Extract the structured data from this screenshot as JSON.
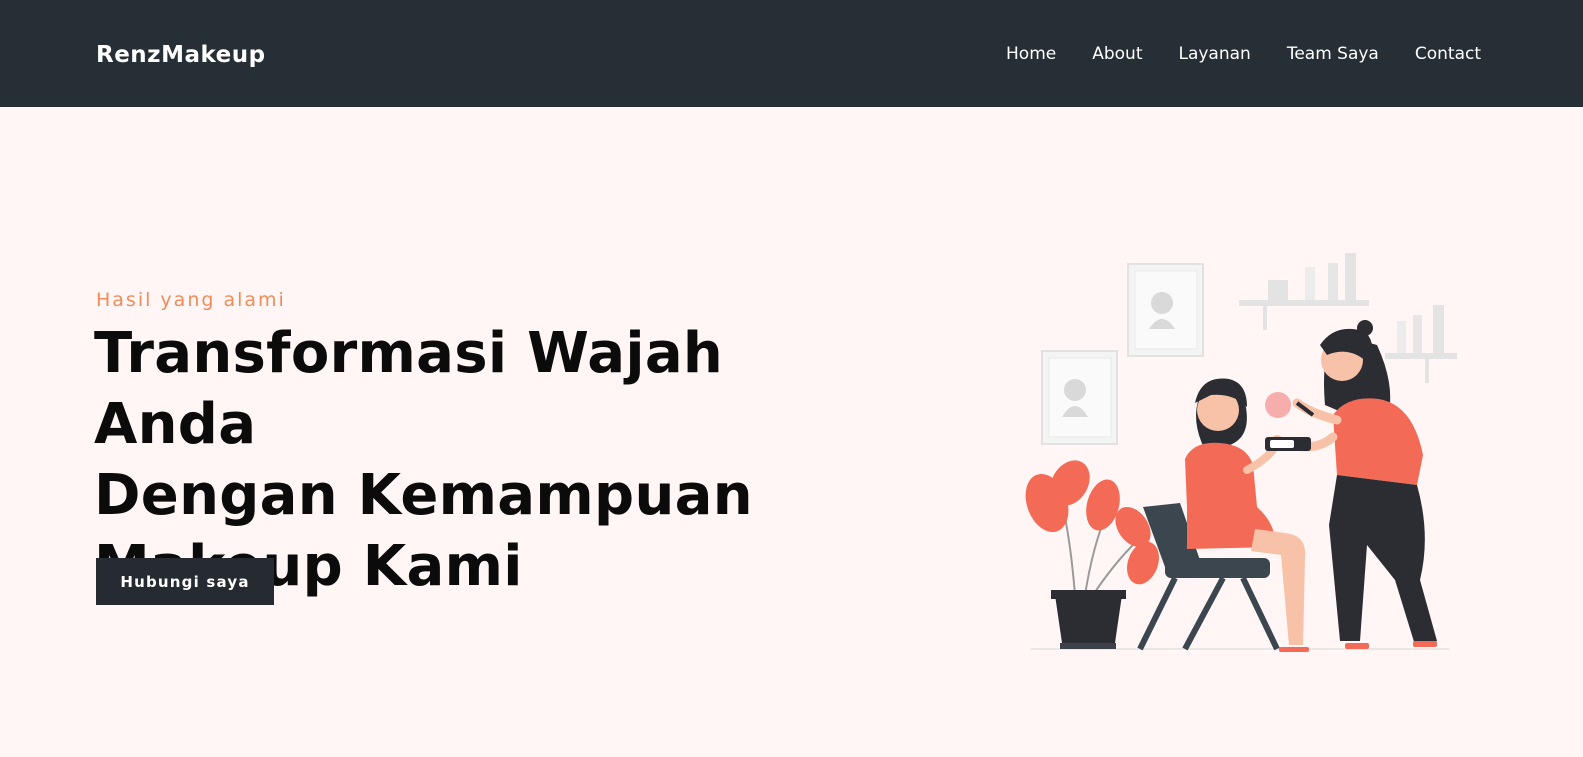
{
  "header": {
    "brand": "RenzMakeup",
    "nav": [
      "Home",
      "About",
      "Layanan",
      "Team Saya",
      "Contact"
    ]
  },
  "hero": {
    "kicker": "Hasil yang alami",
    "title_lines": [
      "Transformasi Wajah Anda",
      "Dengan Kemampuan",
      "Makeup Kami"
    ],
    "cta_label": "Hubungi saya",
    "illustration": "makeup-session-illustration"
  },
  "colors": {
    "nav_bg": "#262f36",
    "page_bg": "#fff6f5",
    "accent": "#f08c5a",
    "illustration_primary": "#f36b56",
    "button_bg": "#262a31"
  }
}
